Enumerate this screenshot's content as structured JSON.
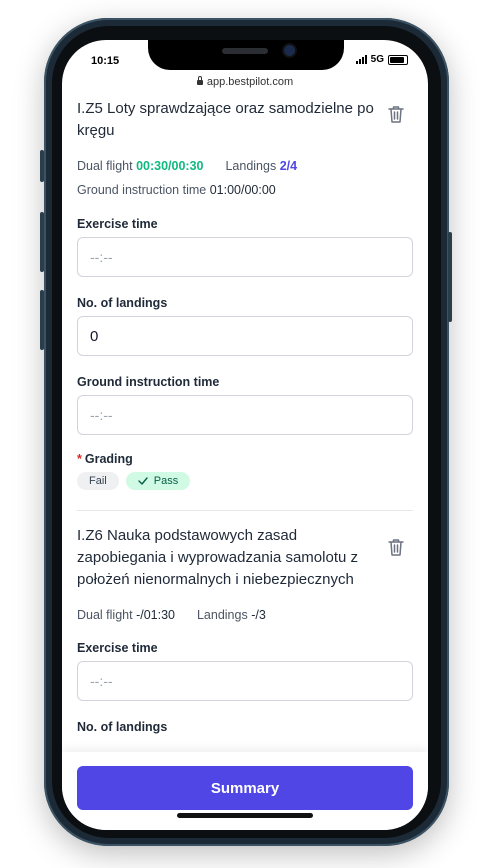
{
  "status_bar": {
    "time": "10:15",
    "network": "5G"
  },
  "browser": {
    "url": "app.bestpilot.com"
  },
  "exercises": [
    {
      "title": "I.Z5 Loty sprawdzające oraz samodzielne po kręgu",
      "dual_flight_label": "Dual flight",
      "dual_flight_value": "00:30/00:30",
      "landings_label": "Landings",
      "landings_value": "2/4",
      "ground_label": "Ground instruction time",
      "ground_value": "01:00/00:00",
      "exercise_time_label": "Exercise time",
      "exercise_time_placeholder": "--:--",
      "landings_field_label": "No. of landings",
      "landings_field_value": "0",
      "ground_field_label": "Ground instruction time",
      "ground_field_placeholder": "--:--",
      "grading_label": "Grading",
      "grading_required_mark": "*",
      "grading_options": [
        "Fail",
        "Pass"
      ],
      "grading_selected": "Pass"
    },
    {
      "title": "I.Z6 Nauka podstawowych zasad zapobiegania i wyprowadzania samolotu z położeń nienormalnych i niebezpiecznych",
      "dual_flight_label": "Dual flight",
      "dual_flight_value": "-/01:30",
      "landings_label": "Landings",
      "landings_value": "-/3",
      "exercise_time_label": "Exercise time",
      "exercise_time_placeholder": "--:--",
      "landings_field_label": "No. of landings"
    }
  ],
  "footer": {
    "summary_label": "Summary"
  },
  "colors": {
    "accent": "#4f46e5",
    "green": "#10b981",
    "pass_bg": "#d1fae5"
  },
  "icons": {
    "delete": "trash-icon",
    "pass": "check-icon",
    "lock": "lock-icon"
  }
}
